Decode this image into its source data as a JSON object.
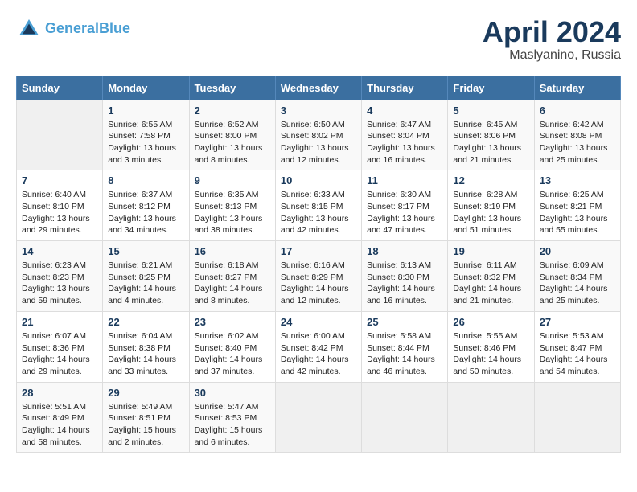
{
  "header": {
    "logo_line1": "General",
    "logo_line2": "Blue",
    "month": "April 2024",
    "location": "Maslyanino, Russia"
  },
  "columns": [
    "Sunday",
    "Monday",
    "Tuesday",
    "Wednesday",
    "Thursday",
    "Friday",
    "Saturday"
  ],
  "weeks": [
    [
      {
        "day": "",
        "sunrise": "",
        "sunset": "",
        "daylight": ""
      },
      {
        "day": "1",
        "sunrise": "Sunrise: 6:55 AM",
        "sunset": "Sunset: 7:58 PM",
        "daylight": "Daylight: 13 hours and 3 minutes."
      },
      {
        "day": "2",
        "sunrise": "Sunrise: 6:52 AM",
        "sunset": "Sunset: 8:00 PM",
        "daylight": "Daylight: 13 hours and 8 minutes."
      },
      {
        "day": "3",
        "sunrise": "Sunrise: 6:50 AM",
        "sunset": "Sunset: 8:02 PM",
        "daylight": "Daylight: 13 hours and 12 minutes."
      },
      {
        "day": "4",
        "sunrise": "Sunrise: 6:47 AM",
        "sunset": "Sunset: 8:04 PM",
        "daylight": "Daylight: 13 hours and 16 minutes."
      },
      {
        "day": "5",
        "sunrise": "Sunrise: 6:45 AM",
        "sunset": "Sunset: 8:06 PM",
        "daylight": "Daylight: 13 hours and 21 minutes."
      },
      {
        "day": "6",
        "sunrise": "Sunrise: 6:42 AM",
        "sunset": "Sunset: 8:08 PM",
        "daylight": "Daylight: 13 hours and 25 minutes."
      }
    ],
    [
      {
        "day": "7",
        "sunrise": "Sunrise: 6:40 AM",
        "sunset": "Sunset: 8:10 PM",
        "daylight": "Daylight: 13 hours and 29 minutes."
      },
      {
        "day": "8",
        "sunrise": "Sunrise: 6:37 AM",
        "sunset": "Sunset: 8:12 PM",
        "daylight": "Daylight: 13 hours and 34 minutes."
      },
      {
        "day": "9",
        "sunrise": "Sunrise: 6:35 AM",
        "sunset": "Sunset: 8:13 PM",
        "daylight": "Daylight: 13 hours and 38 minutes."
      },
      {
        "day": "10",
        "sunrise": "Sunrise: 6:33 AM",
        "sunset": "Sunset: 8:15 PM",
        "daylight": "Daylight: 13 hours and 42 minutes."
      },
      {
        "day": "11",
        "sunrise": "Sunrise: 6:30 AM",
        "sunset": "Sunset: 8:17 PM",
        "daylight": "Daylight: 13 hours and 47 minutes."
      },
      {
        "day": "12",
        "sunrise": "Sunrise: 6:28 AM",
        "sunset": "Sunset: 8:19 PM",
        "daylight": "Daylight: 13 hours and 51 minutes."
      },
      {
        "day": "13",
        "sunrise": "Sunrise: 6:25 AM",
        "sunset": "Sunset: 8:21 PM",
        "daylight": "Daylight: 13 hours and 55 minutes."
      }
    ],
    [
      {
        "day": "14",
        "sunrise": "Sunrise: 6:23 AM",
        "sunset": "Sunset: 8:23 PM",
        "daylight": "Daylight: 13 hours and 59 minutes."
      },
      {
        "day": "15",
        "sunrise": "Sunrise: 6:21 AM",
        "sunset": "Sunset: 8:25 PM",
        "daylight": "Daylight: 14 hours and 4 minutes."
      },
      {
        "day": "16",
        "sunrise": "Sunrise: 6:18 AM",
        "sunset": "Sunset: 8:27 PM",
        "daylight": "Daylight: 14 hours and 8 minutes."
      },
      {
        "day": "17",
        "sunrise": "Sunrise: 6:16 AM",
        "sunset": "Sunset: 8:29 PM",
        "daylight": "Daylight: 14 hours and 12 minutes."
      },
      {
        "day": "18",
        "sunrise": "Sunrise: 6:13 AM",
        "sunset": "Sunset: 8:30 PM",
        "daylight": "Daylight: 14 hours and 16 minutes."
      },
      {
        "day": "19",
        "sunrise": "Sunrise: 6:11 AM",
        "sunset": "Sunset: 8:32 PM",
        "daylight": "Daylight: 14 hours and 21 minutes."
      },
      {
        "day": "20",
        "sunrise": "Sunrise: 6:09 AM",
        "sunset": "Sunset: 8:34 PM",
        "daylight": "Daylight: 14 hours and 25 minutes."
      }
    ],
    [
      {
        "day": "21",
        "sunrise": "Sunrise: 6:07 AM",
        "sunset": "Sunset: 8:36 PM",
        "daylight": "Daylight: 14 hours and 29 minutes."
      },
      {
        "day": "22",
        "sunrise": "Sunrise: 6:04 AM",
        "sunset": "Sunset: 8:38 PM",
        "daylight": "Daylight: 14 hours and 33 minutes."
      },
      {
        "day": "23",
        "sunrise": "Sunrise: 6:02 AM",
        "sunset": "Sunset: 8:40 PM",
        "daylight": "Daylight: 14 hours and 37 minutes."
      },
      {
        "day": "24",
        "sunrise": "Sunrise: 6:00 AM",
        "sunset": "Sunset: 8:42 PM",
        "daylight": "Daylight: 14 hours and 42 minutes."
      },
      {
        "day": "25",
        "sunrise": "Sunrise: 5:58 AM",
        "sunset": "Sunset: 8:44 PM",
        "daylight": "Daylight: 14 hours and 46 minutes."
      },
      {
        "day": "26",
        "sunrise": "Sunrise: 5:55 AM",
        "sunset": "Sunset: 8:46 PM",
        "daylight": "Daylight: 14 hours and 50 minutes."
      },
      {
        "day": "27",
        "sunrise": "Sunrise: 5:53 AM",
        "sunset": "Sunset: 8:47 PM",
        "daylight": "Daylight: 14 hours and 54 minutes."
      }
    ],
    [
      {
        "day": "28",
        "sunrise": "Sunrise: 5:51 AM",
        "sunset": "Sunset: 8:49 PM",
        "daylight": "Daylight: 14 hours and 58 minutes."
      },
      {
        "day": "29",
        "sunrise": "Sunrise: 5:49 AM",
        "sunset": "Sunset: 8:51 PM",
        "daylight": "Daylight: 15 hours and 2 minutes."
      },
      {
        "day": "30",
        "sunrise": "Sunrise: 5:47 AM",
        "sunset": "Sunset: 8:53 PM",
        "daylight": "Daylight: 15 hours and 6 minutes."
      },
      {
        "day": "",
        "sunrise": "",
        "sunset": "",
        "daylight": ""
      },
      {
        "day": "",
        "sunrise": "",
        "sunset": "",
        "daylight": ""
      },
      {
        "day": "",
        "sunrise": "",
        "sunset": "",
        "daylight": ""
      },
      {
        "day": "",
        "sunrise": "",
        "sunset": "",
        "daylight": ""
      }
    ]
  ]
}
